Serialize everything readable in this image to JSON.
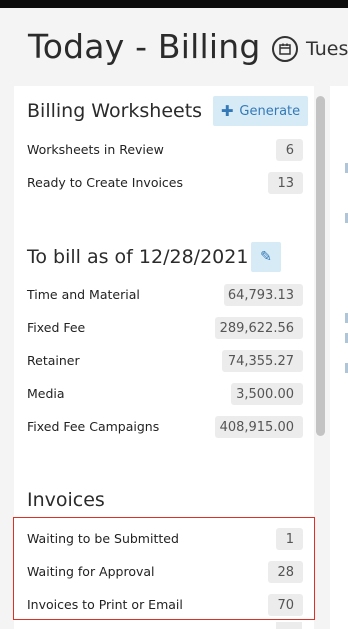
{
  "page": {
    "title": "Today - Billing",
    "date_text": "Tues"
  },
  "billing_worksheets": {
    "title": "Billing Worksheets",
    "generate_label": "Generate",
    "rows": [
      {
        "label": "Worksheets in Review",
        "value": "6"
      },
      {
        "label": "Ready to Create Invoices",
        "value": "13"
      }
    ]
  },
  "to_bill": {
    "title": "To bill as of 12/28/2021",
    "rows": [
      {
        "label": "Time and Material",
        "value": "64,793.13"
      },
      {
        "label": "Fixed Fee",
        "value": "289,622.56"
      },
      {
        "label": "Retainer",
        "value": "74,355.27"
      },
      {
        "label": "Media",
        "value": "3,500.00"
      },
      {
        "label": "Fixed Fee Campaigns",
        "value": "408,915.00"
      }
    ]
  },
  "invoices": {
    "title": "Invoices",
    "rows": [
      {
        "label": "Waiting to be Submitted",
        "value": "1"
      },
      {
        "label": "Waiting for Approval",
        "value": "28"
      },
      {
        "label": "Invoices to Print or Email",
        "value": "70"
      }
    ]
  },
  "colors": {
    "accent": "#3479b7",
    "accent_bg": "#d7ebf7",
    "highlight": "#e02f24"
  },
  "icons": {
    "calendar": "calendar-icon",
    "plus": "plus-icon",
    "edit": "pencil-icon"
  }
}
